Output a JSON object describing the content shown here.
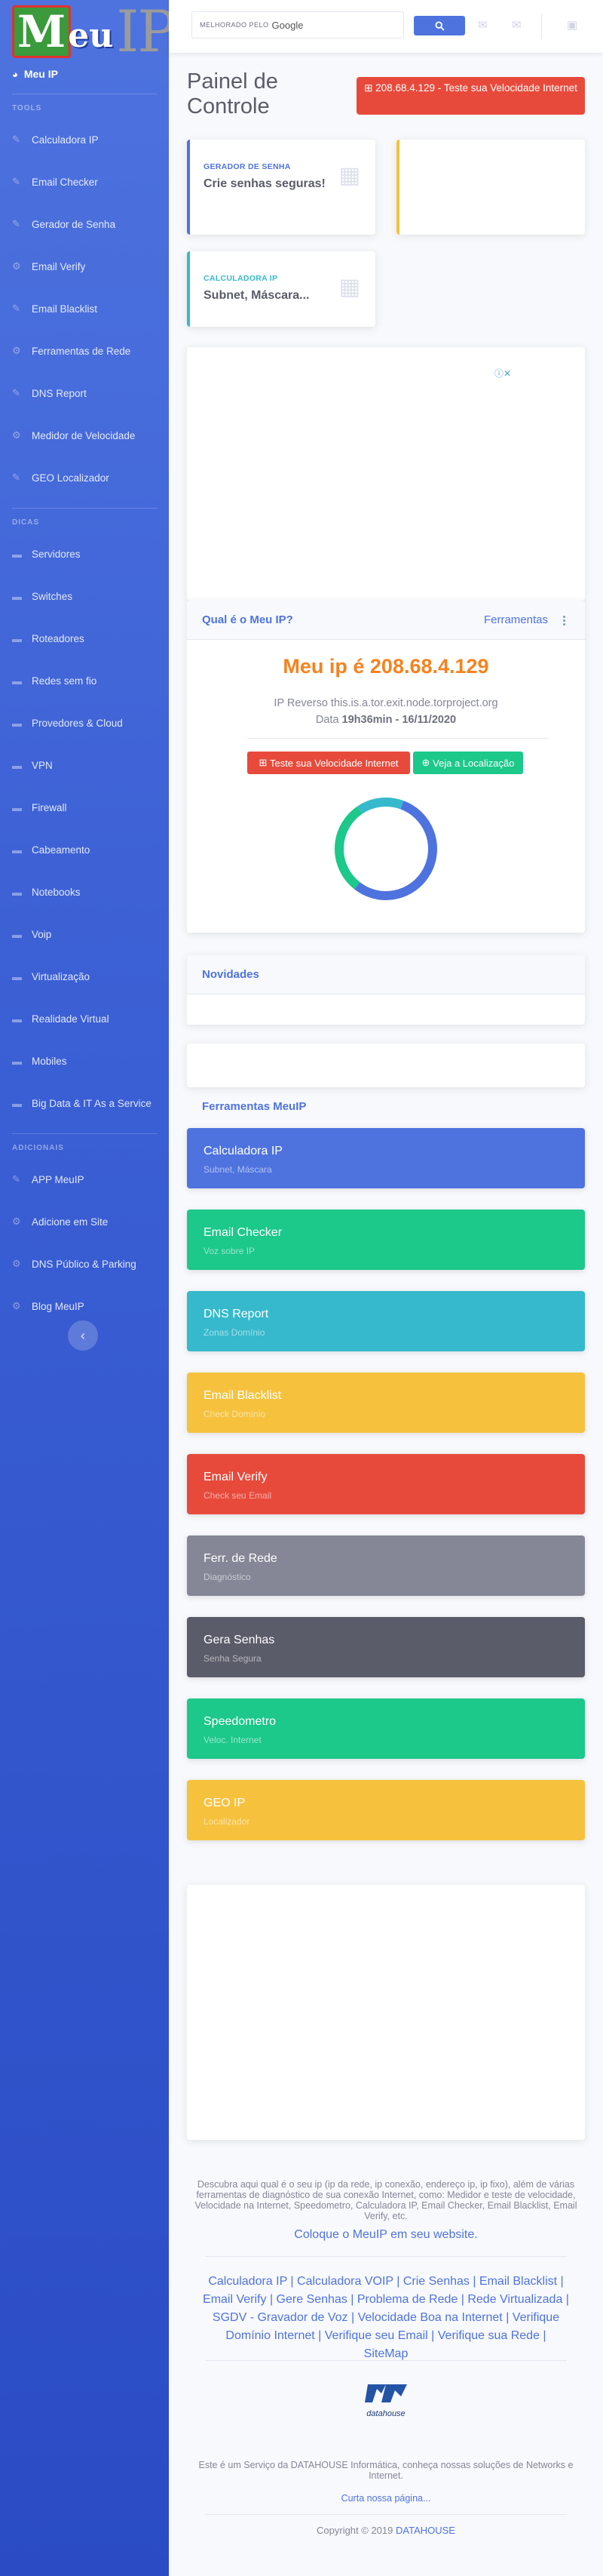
{
  "sidebar": {
    "logo": {
      "m": "M",
      "eu": "eu",
      "ip": "IP"
    },
    "active": {
      "label": "Meu IP"
    },
    "heading_tools": "TOOLS",
    "tools": [
      {
        "label": "Calculadora IP",
        "icon": "wrench-icon"
      },
      {
        "label": "Email Checker",
        "icon": "wrench-icon"
      },
      {
        "label": "Gerador de Senha",
        "icon": "wrench-icon"
      },
      {
        "label": "Email Verify",
        "icon": "gear-icon"
      },
      {
        "label": "Email Blacklist",
        "icon": "wrench-icon"
      },
      {
        "label": "Ferramentas de Rede",
        "icon": "gear-icon"
      },
      {
        "label": "DNS Report",
        "icon": "wrench-icon"
      },
      {
        "label": "Medidor de Velocidade",
        "icon": "gear-icon"
      },
      {
        "label": "GEO Localizador",
        "icon": "wrench-icon"
      }
    ],
    "heading_dicas": "DICAS",
    "dicas": [
      {
        "label": "Servidores"
      },
      {
        "label": "Switches"
      },
      {
        "label": "Roteadores"
      },
      {
        "label": "Redes sem fio"
      },
      {
        "label": "Provedores & Cloud"
      },
      {
        "label": "VPN"
      },
      {
        "label": "Firewall"
      },
      {
        "label": "Cabeamento"
      },
      {
        "label": "Notebooks"
      },
      {
        "label": "Voip"
      },
      {
        "label": "Virtualização"
      },
      {
        "label": "Realidade Virtual"
      },
      {
        "label": "Mobiles"
      },
      {
        "label": "Big Data & IT As a Service"
      }
    ],
    "heading_adicionais": "ADICIONAIS",
    "adicionais": [
      {
        "label": "APP MeuIP",
        "icon": "wrench-icon"
      },
      {
        "label": "Adicione em Site",
        "icon": "gear-icon"
      },
      {
        "label": "DNS Público & Parking",
        "icon": "gear-icon"
      },
      {
        "label": "Blog MeuIP",
        "icon": "gear-icon"
      }
    ],
    "toggle_icon": "‹"
  },
  "topbar": {
    "search_prefix": "MELHORADO PELO",
    "search_brand": "Google",
    "search_icon": "search-icon"
  },
  "page": {
    "title": "Painel de Controle",
    "speed_button": "208.68.4.129 - Teste sua Velocidade Internet"
  },
  "cards": {
    "senha": {
      "label": "GERADOR DE SENHA",
      "value": "Crie senhas seguras!"
    },
    "calc": {
      "label": "CALCULADORA IP",
      "value": "Subnet, Máscara..."
    }
  },
  "ipbox": {
    "header": "Qual é o Meu IP?",
    "tools_link": "Ferramentas",
    "title": "Meu ip é 208.68.4.129",
    "reverse": "IP Reverso this.is.a.tor.exit.node.torproject.org",
    "date_label": "Data",
    "date_value": "19h36min - 16/11/2020",
    "btn_speed": "Teste sua Velocidade Internet",
    "btn_location": "Veja a Localização"
  },
  "novidades": {
    "header": "Novidades"
  },
  "ferramentas": {
    "header": "Ferramentas MeuIP",
    "items": [
      {
        "name": "Calculadora IP",
        "sub": "Subnet, Máscara",
        "color": "#4e73df"
      },
      {
        "name": "Email Checker",
        "sub": "Voz sobre IP",
        "color": "#1cc88a"
      },
      {
        "name": "DNS Report",
        "sub": "Zonas Domínio",
        "color": "#36b9cc"
      },
      {
        "name": "Email Blacklist",
        "sub": "Check Domínio",
        "color": "#f6c23e"
      },
      {
        "name": "Email Verify",
        "sub": "Check seu Email",
        "color": "#e74a3b"
      },
      {
        "name": "Ferr. de Rede",
        "sub": "Diagnóstico",
        "color": "#858796"
      },
      {
        "name": "Gera Senhas",
        "sub": "Senha Segura",
        "color": "#5a5c69"
      },
      {
        "name": "Speedometro",
        "sub": "Veloc. Internet",
        "color": "#1cc88a"
      },
      {
        "name": "GEO IP",
        "sub": "Localizador",
        "color": "#f6c23e"
      }
    ]
  },
  "footer": {
    "description": "Descubra aqui qual é o seu ip (ip da rede, ip conexão, endereço ip, ip fixo), além de várias ferramentas de diagnóstico de sua conexão Internet, como: Medidor e teste de velocidade, Velocidade na Internet, Speedometro, Calculadora IP, Email Checker, Email Blacklist, Email Verify, etc.",
    "cta": "Coloque o MeuIP em seu website.",
    "links": "Calculadora IP | Calculadora VOIP | Crie Senhas | Email Blacklist | Email Verify | Gere Senhas | Problema de Rede | Rede Virtualizada | SGDV - Gravador de Voz | Velocidade Boa na Internet | Verifique Domínio Internet | Verifique seu Email | Verifique sua Rede | SiteMap",
    "datahouse_logo": "datahouse",
    "service_text": "Este é um Serviço da DATAHOUSE Informática, conheça nossas soluções de Networks e Internet.",
    "like": "Curta nossa página...",
    "copyright": "Copyright © 2019",
    "copyright_link": "DATAHOUSE"
  },
  "chart_data": {
    "type": "pie",
    "values": [
      55,
      30,
      15
    ],
    "colors": [
      "#4e73df",
      "#1cc88a",
      "#36b9cc"
    ]
  }
}
